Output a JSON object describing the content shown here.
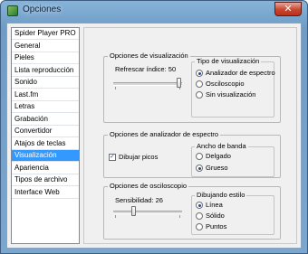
{
  "window": {
    "title": "Opciones",
    "close_label": "✕"
  },
  "sidebar": {
    "items": [
      {
        "label": "Spider Player PRO",
        "active": false
      },
      {
        "label": "General",
        "active": false
      },
      {
        "label": "Pieles",
        "active": false
      },
      {
        "label": "Lista reproducción",
        "active": false
      },
      {
        "label": "Sonido",
        "active": false
      },
      {
        "label": "Last.fm",
        "active": false
      },
      {
        "label": "Letras",
        "active": false
      },
      {
        "label": "Grabación",
        "active": false
      },
      {
        "label": "Convertidor",
        "active": false
      },
      {
        "label": "Atajos de teclas",
        "active": false
      },
      {
        "label": "Visualización",
        "active": true
      },
      {
        "label": "Apariencia",
        "active": false
      },
      {
        "label": "Tipos de archivo",
        "active": false
      },
      {
        "label": "Interface Web",
        "active": false
      }
    ]
  },
  "visualization": {
    "title": "Opciones de visualización",
    "refresh_label": "Refrescar índice: 50",
    "refresh_value": 50,
    "type_group": {
      "title": "Tipo de visualización",
      "options": [
        {
          "label": "Analizador de espectro",
          "checked": true
        },
        {
          "label": "Osciloscopio",
          "checked": false
        },
        {
          "label": "Sin visualización",
          "checked": false
        }
      ]
    }
  },
  "spectrum": {
    "title": "Opciones de analizador de espectro",
    "draw_peaks_label": "Dibujar picos",
    "draw_peaks_checked": true,
    "bandwidth_group": {
      "title": "Ancho de banda",
      "options": [
        {
          "label": "Delgado",
          "checked": false
        },
        {
          "label": "Grueso",
          "checked": true
        }
      ]
    }
  },
  "oscilloscope": {
    "title": "Opciones de osciloscopio",
    "sensitivity_label": "Sensibilidad: 26",
    "sensitivity_value": 26,
    "style_group": {
      "title": "Dibujando estilo",
      "options": [
        {
          "label": "Línea",
          "checked": true
        },
        {
          "label": "Sólido",
          "checked": false
        },
        {
          "label": "Puntos",
          "checked": false
        }
      ]
    }
  },
  "icons": {
    "app": "app-icon",
    "close": "close-icon"
  }
}
